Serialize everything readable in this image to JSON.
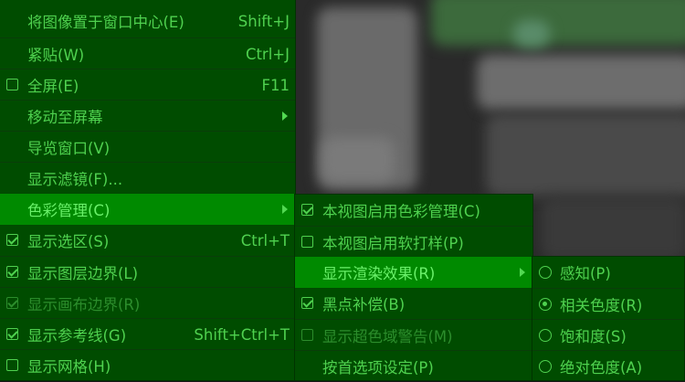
{
  "colors": {
    "menu_bg": "#004c00",
    "menu_text": "#4fd14f",
    "highlight_bg": "#008a00",
    "disabled_text": "#2c8d2c"
  },
  "main_menu": {
    "items": [
      {
        "label": "将图像置于窗口中心(E)",
        "shortcut": "Shift+J"
      },
      {
        "label": "紧贴(W)",
        "shortcut": "Ctrl+J"
      },
      {
        "label": "全屏(E)",
        "shortcut": "F11",
        "checkbox": "unchecked"
      },
      {
        "label": "移动至屏幕",
        "submenu": true
      },
      {
        "label": "导览窗口(V)"
      },
      {
        "label": "显示滤镜(F)..."
      },
      {
        "label": "色彩管理(C)",
        "submenu": true,
        "highlighted": true
      },
      {
        "label": "显示选区(S)",
        "shortcut": "Ctrl+T",
        "checkbox": "checked"
      },
      {
        "label": "显示图层边界(L)",
        "checkbox": "checked"
      },
      {
        "label": "显示画布边界(R)",
        "checkbox": "checked",
        "disabled": true
      },
      {
        "label": "显示参考线(G)",
        "shortcut": "Shift+Ctrl+T",
        "checkbox": "checked"
      },
      {
        "label": "显示网格(H)",
        "checkbox": "unchecked"
      }
    ]
  },
  "color_management_menu": {
    "items": [
      {
        "label": "本视图启用色彩管理(C)",
        "checkbox": "checked"
      },
      {
        "label": "本视图启用软打样(P)",
        "checkbox": "unchecked"
      },
      {
        "label": "显示渲染效果(R)",
        "submenu": true,
        "highlighted": true
      },
      {
        "label": "黑点补偿(B)",
        "checkbox": "checked"
      },
      {
        "label": "显示超色域警告(M)",
        "checkbox": "unchecked",
        "disabled": true
      },
      {
        "label": "按首选项设定(P)"
      }
    ]
  },
  "rendering_intent_menu": {
    "items": [
      {
        "label": "感知(P)",
        "radio": "unselected"
      },
      {
        "label": "相关色度(R)",
        "radio": "selected"
      },
      {
        "label": "饱和度(S)",
        "radio": "unselected"
      },
      {
        "label": "绝对色度(A)",
        "radio": "unselected"
      }
    ]
  },
  "icons": {
    "submenu_arrow": "triangle-right-icon",
    "checkbox": "checkbox-icon",
    "radio": "radio-button-icon"
  }
}
